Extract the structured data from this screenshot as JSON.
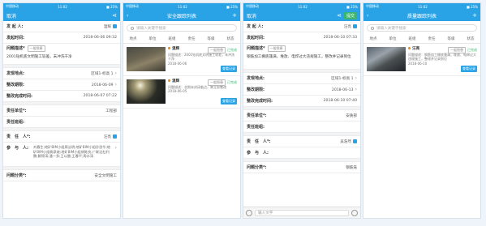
{
  "status": {
    "carrier": "中国移动",
    "time": "11:02",
    "battery": "■ 25%"
  },
  "s1": {
    "nav_left": "取消",
    "nav_right_icon": "share-icon",
    "initiator_label": "发 起 人:",
    "initiator_value": "温辉",
    "time_label": "发起时间:",
    "time_value": "2018-06-06 09:32",
    "desc_label": "问题描述*",
    "desc_tag": "一般隐患",
    "desc_text": "2001钻机底文明施工较差，未冲洗干净",
    "location_label": "发现地点:",
    "location_value": "区域1-标高 1",
    "deadline_label": "整改期限:",
    "deadline_value": "2018-06-09",
    "finish_label": "整改完成时间:",
    "finish_value": "2018-06-07 07:22",
    "unit_label": "责任单位*:",
    "unit_value": "工程部",
    "team_label": "责任班组:",
    "team_value": "",
    "person_label": "责　任　人*:",
    "person_value": "汪亮",
    "cc_label": "参　与　人:",
    "cc_value": "刘春生;地矿BIM小组周洁明;地矿BIM小组孙思华;地矿BIM小组杨泉继;地矿BIM小组胡陈良;广联达杜利鹏;解锦涛;潘一多;王以雷;王春平;周水涛",
    "type_label": "问题分类*:",
    "type_value": "安全文明施工"
  },
  "s2": {
    "title": "安全跟踪列表",
    "add_icon": "plus-icon",
    "search_placeholder": "请输入关键字搜索",
    "filters": [
      "地点",
      "单位",
      "班组",
      "责任",
      "等级",
      "状态"
    ],
    "cards": [
      {
        "owner": "温辉",
        "tag": "一般隐患",
        "status": "已完成",
        "desc": "问题描述：2001钻机底文明施工较差，未冲洗干净",
        "date": "2018-06-06",
        "btn": "查看记录"
      },
      {
        "owner": "温辉",
        "tag": "一般隐患",
        "status": "已完成",
        "desc": "问题描述：北侧未封闭临边，需立即整改",
        "date": "2018-06-05",
        "btn": "查看记录"
      }
    ]
  },
  "s3": {
    "nav_left": "取消",
    "nav_right_icon": "share-icon",
    "submit": "提交",
    "initiator_label": "发 起 人:",
    "initiator_value": "汪亮",
    "time_label": "发起时间:",
    "time_value": "2018-06-10 07:33",
    "desc_label": "问题描述*",
    "desc_tag": "一般隐患",
    "desc_text": "钢筋加工棚底篷满，堆放、电焊过大违规施工，整改并记录到位",
    "location_label": "发现地点:",
    "location_value": "区域1-标高 1",
    "deadline_label": "整改期限:",
    "deadline_value": "2018-06-13",
    "finish_label": "整改完成时间:",
    "finish_value": "2018-06-10 07:40",
    "unit_label": "责任单位*:",
    "unit_value": "安质部",
    "team_label": "责任班组:",
    "team_value": "",
    "person_label": "责　任　人*:",
    "person_value": "吴浩然",
    "cc_label": "参　与　人:",
    "cc_value": "",
    "type_label": "问题分类*:",
    "type_value": "钢筋笼",
    "input_placeholder": "输入文字"
  },
  "s4": {
    "title": "质量跟踪列表",
    "add_icon": "plus-icon",
    "search_placeholder": "请输入关键字搜索",
    "filters": [
      "地点",
      "单位",
      "班组",
      "责任",
      "等级",
      "状态"
    ],
    "cards": [
      {
        "owner": "汪亮",
        "tag": "一般隐患",
        "status": "已完成",
        "desc": "问题描述：钢筋加工棚底篷满，堆放、电焊过大违规施工，整改并记录到位",
        "date": "2018-06-10",
        "btn": "查看记录"
      }
    ]
  }
}
